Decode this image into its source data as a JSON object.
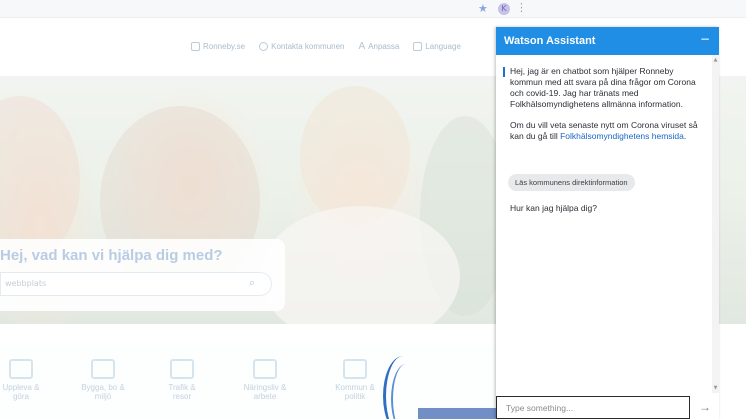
{
  "browser": {
    "star_icon": "star-icon",
    "profile_initial": "K",
    "menu_icon": "menu-dots-icon"
  },
  "site": {
    "top_links": [
      {
        "label": "Ronneby.se",
        "icon": "building-icon"
      },
      {
        "label": "Kontakta kommunen",
        "icon": "person-icon"
      },
      {
        "label": "Anpassa",
        "icon": "text-size-icon"
      },
      {
        "label": "Language",
        "icon": "translate-icon"
      }
    ],
    "search": {
      "heading": "Hej, vad kan vi hjälpa dig med?",
      "placeholder": "webbplats"
    },
    "categories": [
      {
        "label": "Uppleva &\ngöra",
        "icon": "camera-icon"
      },
      {
        "label": "Bygga, bo &\nmiljö",
        "icon": "house-icon"
      },
      {
        "label": "Trafik &\nresor",
        "icon": "bus-icon"
      },
      {
        "label": "Näringsliv &\narbete",
        "icon": "handshake-icon"
      },
      {
        "label": "Kommun &\npolitik",
        "icon": "gavel-icon"
      }
    ]
  },
  "chat": {
    "title": "Watson Assistant",
    "minimize_label": "−",
    "messages": {
      "intro": "Hej, jag är en chatbot som hjälper Ronneby kommun med att svara på dina frågor om Corona och covid-19. Jag har tränats med Folkhälsomyndighetens allmänna information.",
      "info_prefix": "Om du vill veta senaste nytt om Corona viruset så kan du gå till ",
      "info_link": "Folkhälsomyndighetens hemsida",
      "info_suffix": ".",
      "question": "Hur kan jag hjälpa dig?"
    },
    "chip_label": "Läs kommunens direktinformation",
    "input_placeholder": "Type something...",
    "send_label": "→"
  }
}
